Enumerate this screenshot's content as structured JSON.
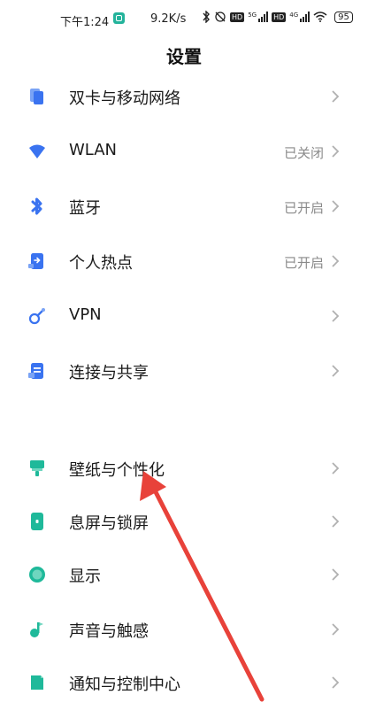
{
  "status_bar": {
    "time": "下午1:24",
    "net_speed": "9.2K/s",
    "sim1_tag": "5G",
    "sim2_tag": "4G",
    "hd1": "HD",
    "hd2": "HD",
    "battery": "95"
  },
  "page": {
    "title": "设置"
  },
  "items": [
    {
      "label": "双卡与移动网络",
      "status": "",
      "icon": "sim-card-icon",
      "color": "#3a73f0"
    },
    {
      "label": "WLAN",
      "status": "已关闭",
      "icon": "wifi-icon",
      "color": "#3a73f0"
    },
    {
      "label": "蓝牙",
      "status": "已开启",
      "icon": "bluetooth-icon",
      "color": "#3a73f0"
    },
    {
      "label": "个人热点",
      "status": "已开启",
      "icon": "hotspot-icon",
      "color": "#3a73f0"
    },
    {
      "label": "VPN",
      "status": "",
      "icon": "vpn-key-icon",
      "color": "#3a73f0"
    },
    {
      "label": "连接与共享",
      "status": "",
      "icon": "connection-share-icon",
      "color": "#3a73f0"
    },
    {
      "label": "壁纸与个性化",
      "status": "",
      "icon": "wallpaper-icon",
      "color": "#1fb99a"
    },
    {
      "label": "息屏与锁屏",
      "status": "",
      "icon": "lock-screen-icon",
      "color": "#1fb99a"
    },
    {
      "label": "显示",
      "status": "",
      "icon": "display-icon",
      "color": "#1fb99a"
    },
    {
      "label": "声音与触感",
      "status": "",
      "icon": "sound-icon",
      "color": "#1fb99a"
    },
    {
      "label": "通知与控制中心",
      "status": "",
      "icon": "notification-icon",
      "color": "#1fb99a"
    }
  ],
  "annotation": {
    "color": "#e8423a"
  }
}
